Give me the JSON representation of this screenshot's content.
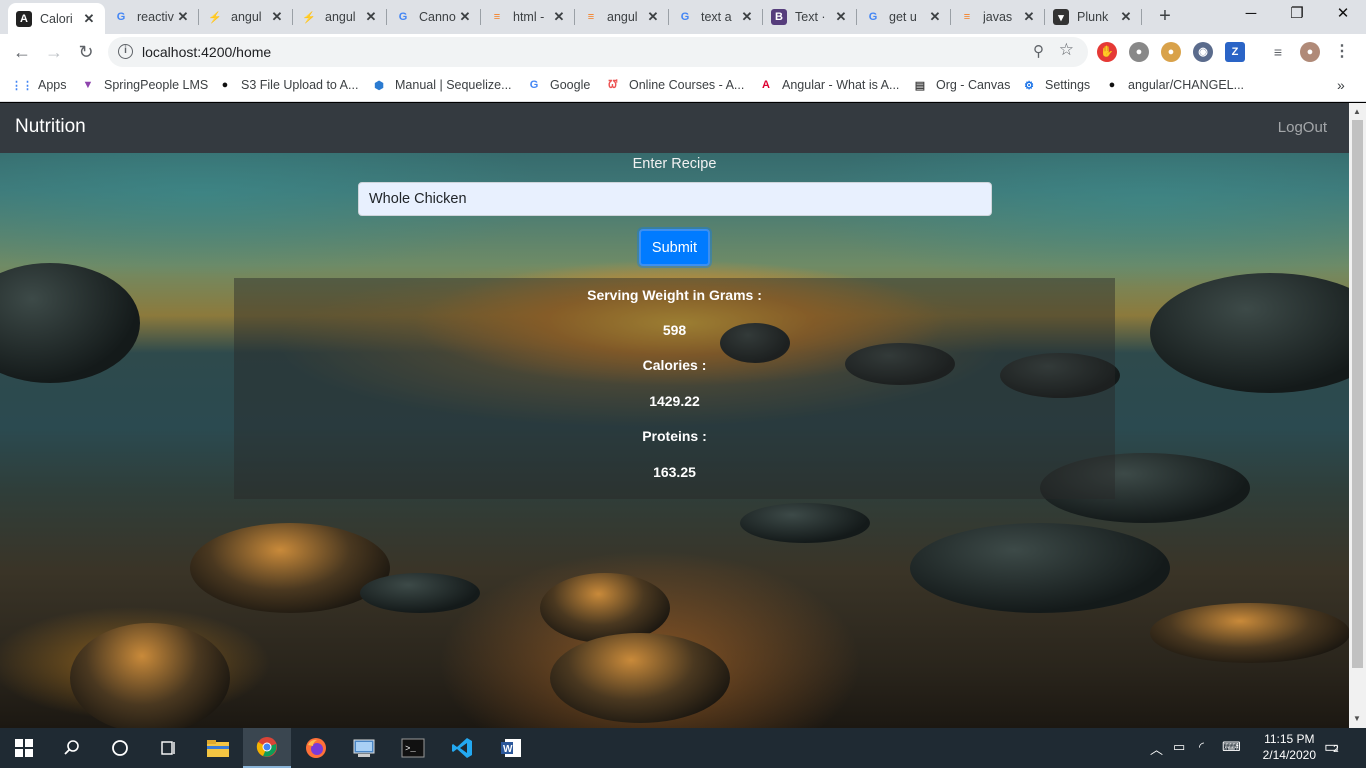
{
  "browser": {
    "tabs": [
      {
        "label": "Calori",
        "icon": "angular-icon",
        "icon_char": "A",
        "icon_bg": "#222",
        "icon_color": "#fff",
        "active": true
      },
      {
        "label": "reactiv",
        "icon": "google-icon",
        "icon_char": "G",
        "icon_bg": "transparent",
        "icon_color": "#4285f4"
      },
      {
        "label": "angul",
        "icon": "stackblitz-icon",
        "icon_char": "⚡",
        "icon_bg": "transparent",
        "icon_color": "#1389fd"
      },
      {
        "label": "angul",
        "icon": "stackblitz-icon",
        "icon_char": "⚡",
        "icon_bg": "transparent",
        "icon_color": "#1389fd"
      },
      {
        "label": "Canno",
        "icon": "google-icon",
        "icon_char": "G",
        "icon_bg": "transparent",
        "icon_color": "#4285f4"
      },
      {
        "label": "html -",
        "icon": "stackoverflow-icon",
        "icon_char": "≡",
        "icon_bg": "transparent",
        "icon_color": "#f48024"
      },
      {
        "label": "angul",
        "icon": "stackoverflow-icon",
        "icon_char": "≡",
        "icon_bg": "transparent",
        "icon_color": "#f48024"
      },
      {
        "label": "text a",
        "icon": "google-icon",
        "icon_char": "G",
        "icon_bg": "transparent",
        "icon_color": "#4285f4"
      },
      {
        "label": "Text ·",
        "icon": "bootstrap-icon",
        "icon_char": "B",
        "icon_bg": "#563d7c",
        "icon_color": "#fff"
      },
      {
        "label": "get u",
        "icon": "google-icon",
        "icon_char": "G",
        "icon_bg": "transparent",
        "icon_color": "#4285f4"
      },
      {
        "label": "javas",
        "icon": "stackoverflow-icon",
        "icon_char": "≡",
        "icon_bg": "transparent",
        "icon_color": "#f48024"
      },
      {
        "label": "Plunk",
        "icon": "plunker-icon",
        "icon_char": "▾",
        "icon_bg": "#333",
        "icon_color": "#fff"
      }
    ],
    "url": "localhost:4200/home",
    "bookmarks": [
      {
        "label": "Apps",
        "icon": "apps-grid-icon",
        "icon_char": "⋮⋮",
        "color": "#4285f4"
      },
      {
        "label": "SpringPeople LMS",
        "icon": "springpeople-icon",
        "icon_char": "▼",
        "color": "#8e44ad"
      },
      {
        "label": "S3 File Upload to A...",
        "icon": "github-icon",
        "icon_char": "●",
        "color": "#111"
      },
      {
        "label": "Manual | Sequelize...",
        "icon": "sequelize-icon",
        "icon_char": "⬢",
        "color": "#2b7bd1"
      },
      {
        "label": "Google",
        "icon": "google-icon",
        "icon_char": "G",
        "color": "#4285f4"
      },
      {
        "label": "Online Courses - A...",
        "icon": "udemy-icon",
        "icon_char": "ᘺ",
        "color": "#ec5252"
      },
      {
        "label": "Angular - What is A...",
        "icon": "angular-icon",
        "icon_char": "A",
        "color": "#dd0031"
      },
      {
        "label": "Org - Canvas",
        "icon": "document-icon",
        "icon_char": "▤",
        "color": "#444"
      },
      {
        "label": "Settings",
        "icon": "gear-icon",
        "icon_char": "⚙",
        "color": "#1a73e8"
      },
      {
        "label": "angular/CHANGEL...",
        "icon": "github-icon",
        "icon_char": "●",
        "color": "#111"
      }
    ]
  },
  "app": {
    "brand": "Nutrition",
    "logout_label": "LogOut",
    "recipe_label": "Enter Recipe",
    "recipe_value": "Whole Chicken",
    "submit_label": "Submit",
    "results": [
      {
        "label": "Serving Weight in Grams :",
        "value": "598"
      },
      {
        "label": "Calories :",
        "value": "1429.22"
      },
      {
        "label": "Proteins :",
        "value": "163.25"
      }
    ]
  },
  "taskbar": {
    "time": "11:15 PM",
    "date": "2/14/2020",
    "notification_count": "2"
  }
}
